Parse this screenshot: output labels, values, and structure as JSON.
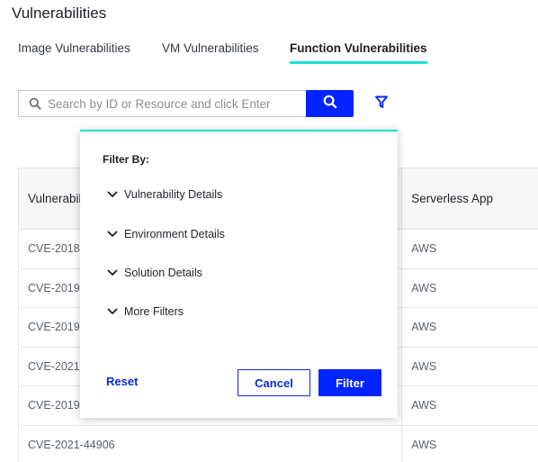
{
  "page": {
    "title": "Vulnerabilities"
  },
  "tabs": [
    {
      "label": "Image Vulnerabilities",
      "active": false
    },
    {
      "label": "VM Vulnerabilities",
      "active": false
    },
    {
      "label": "Function Vulnerabilities",
      "active": true
    }
  ],
  "search": {
    "placeholder": "Search by ID or Resource and click Enter",
    "value": ""
  },
  "icons": {
    "search_field": "search-icon",
    "search_button": "search-icon",
    "filter": "filter-funnel-icon",
    "section_toggle": "chevron-down-icon"
  },
  "colors": {
    "primary": "#0024ff",
    "accent": "#1de0d6",
    "link": "#0a2bdb"
  },
  "table": {
    "columns": [
      "Vulnerabili",
      "Serverless App"
    ],
    "rows": [
      [
        "CVE-2018-",
        "AWS"
      ],
      [
        "CVE-2019-",
        "AWS"
      ],
      [
        "CVE-2019-",
        "AWS"
      ],
      [
        "CVE-2021-",
        "AWS"
      ],
      [
        "CVE-2019-",
        "AWS"
      ],
      [
        "CVE-2021-44906",
        "AWS"
      ]
    ]
  },
  "filter_panel": {
    "title": "Filter By:",
    "sections": [
      "Vulnerability Details",
      "Environment Details",
      "Solution Details",
      "More Filters"
    ],
    "reset_label": "Reset",
    "cancel_label": "Cancel",
    "apply_label": "Filter"
  }
}
